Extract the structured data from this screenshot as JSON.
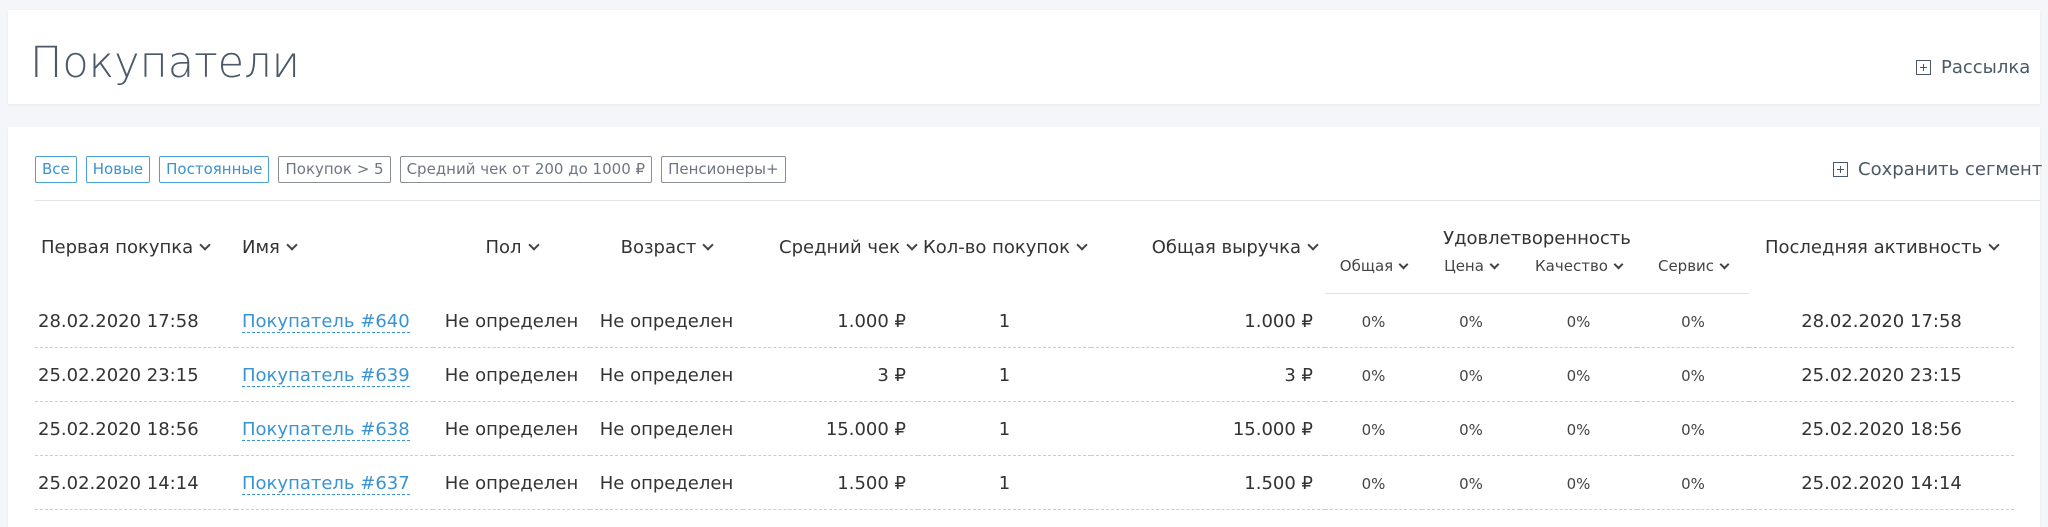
{
  "header": {
    "title": "Покупатели",
    "newsletter_label": "Рассылка"
  },
  "filters": {
    "chips": [
      {
        "label": "Все",
        "active": true
      },
      {
        "label": "Новые",
        "active": true
      },
      {
        "label": "Постоянные",
        "active": true
      },
      {
        "label": "Покупок > 5",
        "active": false
      },
      {
        "label": "Средний чек от 200 до 1000 ₽",
        "active": false
      },
      {
        "label": "Пенсионеры+",
        "active": false
      }
    ],
    "save_segment_label": "Сохранить сегмент"
  },
  "table": {
    "columns": {
      "first_purchase": "Первая покупка",
      "name": "Имя",
      "gender": "Пол",
      "age": "Возраст",
      "avg_check": "Средний чек",
      "purchases": "Кол-во покупок",
      "revenue": "Общая выручка",
      "satisfaction": "Удовлетворенность",
      "sat_total": "Общая",
      "sat_price": "Цена",
      "sat_quality": "Качество",
      "sat_service": "Сервис",
      "last_activity": "Последняя активность"
    },
    "rows": [
      {
        "first_purchase": "28.02.2020 17:58",
        "name": "Покупатель #640",
        "gender": "Не определен",
        "age": "Не определен",
        "avg_check": "1.000 ₽",
        "purchases": "1",
        "revenue": "1.000 ₽",
        "sat_total": "0%",
        "sat_price": "0%",
        "sat_quality": "0%",
        "sat_service": "0%",
        "last_activity": "28.02.2020 17:58"
      },
      {
        "first_purchase": "25.02.2020 23:15",
        "name": "Покупатель #639",
        "gender": "Не определен",
        "age": "Не определен",
        "avg_check": "3 ₽",
        "purchases": "1",
        "revenue": "3 ₽",
        "sat_total": "0%",
        "sat_price": "0%",
        "sat_quality": "0%",
        "sat_service": "0%",
        "last_activity": "25.02.2020 23:15"
      },
      {
        "first_purchase": "25.02.2020 18:56",
        "name": "Покупатель #638",
        "gender": "Не определен",
        "age": "Не определен",
        "avg_check": "15.000 ₽",
        "purchases": "1",
        "revenue": "15.000 ₽",
        "sat_total": "0%",
        "sat_price": "0%",
        "sat_quality": "0%",
        "sat_service": "0%",
        "last_activity": "25.02.2020 18:56"
      },
      {
        "first_purchase": "25.02.2020 14:14",
        "name": "Покупатель #637",
        "gender": "Не определен",
        "age": "Не определен",
        "avg_check": "1.500 ₽",
        "purchases": "1",
        "revenue": "1.500 ₽",
        "sat_total": "0%",
        "sat_price": "0%",
        "sat_quality": "0%",
        "sat_service": "0%",
        "last_activity": "25.02.2020 14:14"
      }
    ]
  }
}
